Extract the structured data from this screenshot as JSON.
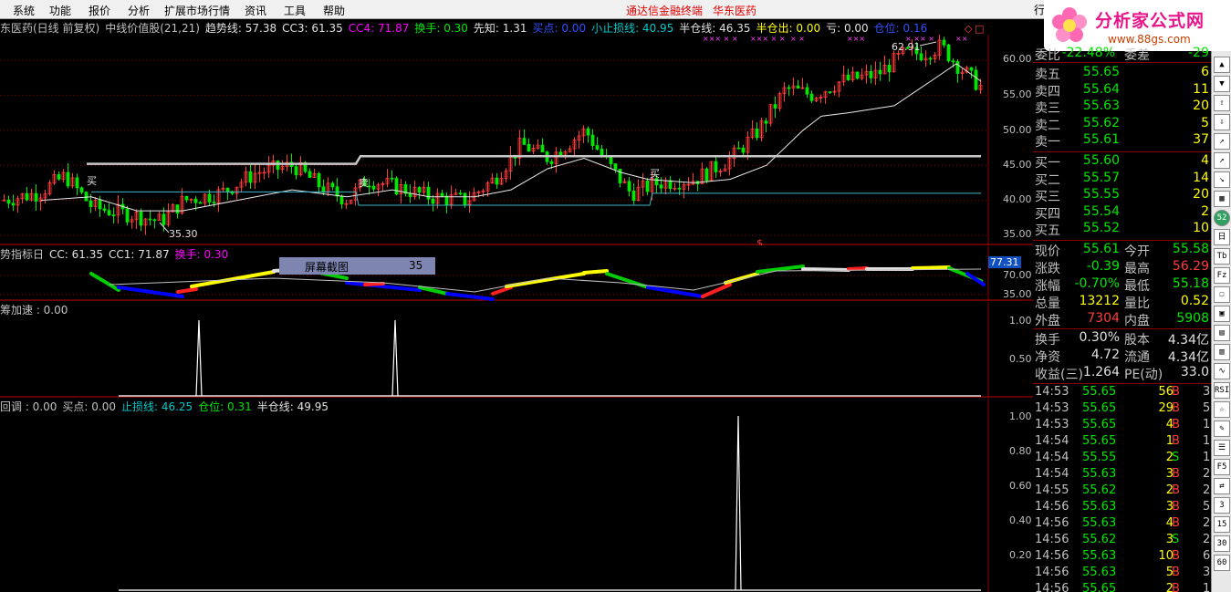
{
  "menu": {
    "items": [
      "系统",
      "功能",
      "报价",
      "分析",
      "扩展市场行情",
      "资讯",
      "工具",
      "帮助"
    ],
    "title": "通达信金融终端",
    "stock": "华东医药",
    "tab_label": "行"
  },
  "logo": {
    "brand": "分析家公式网",
    "url": "www.88gs.com"
  },
  "main_chart": {
    "title_parts": [
      {
        "text": "东医药(日线 前复权)",
        "color": "#c0c0c0"
      },
      {
        "text": "中线价值股(21,21)",
        "color": "#c0c0c0"
      },
      {
        "text": "趋势线: 57.38",
        "color": "#e0e0e0"
      },
      {
        "text": "CC3: 61.35",
        "color": "#e0e0e0"
      },
      {
        "text": "CC4: 71.87",
        "color": "#ff00ff"
      },
      {
        "text": "换手: 0.30",
        "color": "#00e600"
      },
      {
        "text": "先知: 1.31",
        "color": "#e0e0e0"
      },
      {
        "text": "买点: 0.00",
        "color": "#3050ff"
      },
      {
        "text": "小止损线: 40.95",
        "color": "#00c8c8"
      },
      {
        "text": "半仓线: 46.35",
        "color": "#e0e0e0"
      },
      {
        "text": "半仓出: 0.00",
        "color": "#ffff00"
      },
      {
        "text": "亏: 0.00",
        "color": "#e0e0e0"
      },
      {
        "text": "仓位: 0.16",
        "color": "#3050ff"
      }
    ],
    "y_ticks": [
      "60.00",
      "55.00",
      "50.00",
      "45.00",
      "40.00",
      "35.00"
    ],
    "labels": {
      "high": "62.91",
      "low": "35.30",
      "buy1": "买",
      "sell1": "卖",
      "buy2": "买",
      "dollar": "$"
    }
  },
  "indicator1": {
    "title_parts": [
      {
        "text": "势指标日",
        "color": "#c0c0c0"
      },
      {
        "text": "CC: 61.35",
        "color": "#e0e0e0"
      },
      {
        "text": "CC1: 71.87",
        "color": "#e0e0e0"
      },
      {
        "text": "换手: 0.30",
        "color": "#ff00ff"
      }
    ],
    "y_ticks": [
      "77.31",
      "70.00",
      "35.00"
    ]
  },
  "popup": {
    "label": "屏幕截图",
    "value": "35"
  },
  "indicator2": {
    "title_parts": [
      {
        "text": "筹加速 : 0.00",
        "color": "#c0c0c0"
      }
    ],
    "y_ticks": [
      "1.00",
      "0.50"
    ]
  },
  "indicator3": {
    "title_parts": [
      {
        "text": "回调 : 0.00",
        "color": "#c0c0c0"
      },
      {
        "text": "买点: 0.00",
        "color": "#c0c0c0"
      },
      {
        "text": "止损线: 46.25",
        "color": "#00c8c8"
      },
      {
        "text": "仓位: 0.31",
        "color": "#00e600"
      },
      {
        "text": "半仓线: 49.95",
        "color": "#e0e0e0"
      }
    ],
    "y_ticks": [
      "1.00",
      "0.80",
      "0.60",
      "0.40",
      "0.20"
    ]
  },
  "quote": {
    "header": {
      "label": "委比",
      "value": "-22.48%",
      "label2": "委差",
      "value2": "-29"
    },
    "asks": [
      {
        "label": "卖五",
        "price": "55.65",
        "vol": "6"
      },
      {
        "label": "卖四",
        "price": "55.64",
        "vol": "11"
      },
      {
        "label": "卖三",
        "price": "55.63",
        "vol": "20"
      },
      {
        "label": "卖二",
        "price": "55.62",
        "vol": "5"
      },
      {
        "label": "卖一",
        "price": "55.61",
        "vol": "37"
      }
    ],
    "bids": [
      {
        "label": "买一",
        "price": "55.60",
        "vol": "4"
      },
      {
        "label": "买二",
        "price": "55.57",
        "vol": "14"
      },
      {
        "label": "买三",
        "price": "55.55",
        "vol": "20"
      },
      {
        "label": "买四",
        "price": "55.54",
        "vol": "2"
      },
      {
        "label": "买五",
        "price": "55.52",
        "vol": "10"
      }
    ],
    "stats": [
      {
        "l1": "现价",
        "v1": "55.61",
        "c1": "green",
        "l2": "今开",
        "v2": "55.58",
        "c2": "green"
      },
      {
        "l1": "涨跌",
        "v1": "-0.39",
        "c1": "green",
        "l2": "最高",
        "v2": "56.29",
        "c2": "red"
      },
      {
        "l1": "涨幅",
        "v1": "-0.70%",
        "c1": "green",
        "l2": "最低",
        "v2": "55.18",
        "c2": "green"
      },
      {
        "l1": "总量",
        "v1": "13212",
        "c1": "yellow",
        "l2": "量比",
        "v2": "0.52",
        "c2": "yellow"
      },
      {
        "l1": "外盘",
        "v1": "7304",
        "c1": "red",
        "l2": "内盘",
        "v2": "5908",
        "c2": "green"
      }
    ],
    "stats2": [
      {
        "l1": "换手",
        "v1": "0.30%",
        "c1": "white",
        "l2": "股本",
        "v2": "4.34亿",
        "c2": "white"
      },
      {
        "l1": "净资",
        "v1": "4.72",
        "c1": "white",
        "l2": "流通",
        "v2": "4.34亿",
        "c2": "white"
      },
      {
        "l1": "收益(三)",
        "v1": "1.264",
        "c1": "white",
        "l2": "PE(动)",
        "v2": "33.0",
        "c2": "white"
      }
    ],
    "ticks": [
      {
        "time": "14:53",
        "price": "55.65",
        "vol": "56",
        "bs": "B",
        "n": "3"
      },
      {
        "time": "14:53",
        "price": "55.65",
        "vol": "29",
        "bs": "B",
        "n": "5"
      },
      {
        "time": "14:53",
        "price": "55.65",
        "vol": "4",
        "bs": "B",
        "n": "1"
      },
      {
        "time": "14:54",
        "price": "55.65",
        "vol": "1",
        "bs": "B",
        "n": "1"
      },
      {
        "time": "14:54",
        "price": "55.55",
        "vol": "2",
        "bs": "S",
        "n": "1"
      },
      {
        "time": "14:54",
        "price": "55.63",
        "vol": "3",
        "bs": "B",
        "n": "2"
      },
      {
        "time": "14:55",
        "price": "55.62",
        "vol": "2",
        "bs": "B",
        "n": "2"
      },
      {
        "time": "14:56",
        "price": "55.63",
        "vol": "3",
        "bs": "B",
        "n": "5"
      },
      {
        "time": "14:56",
        "price": "55.63",
        "vol": "4",
        "bs": "B",
        "n": "2"
      },
      {
        "time": "14:56",
        "price": "55.62",
        "vol": "3",
        "bs": "S",
        "n": "2"
      },
      {
        "time": "14:56",
        "price": "55.63",
        "vol": "10",
        "bs": "B",
        "n": "6"
      },
      {
        "time": "14:56",
        "price": "55.63",
        "vol": "5",
        "bs": "B",
        "n": "3"
      },
      {
        "time": "14:56",
        "price": "55.65",
        "vol": "2",
        "bs": "B",
        "n": "1"
      }
    ]
  },
  "toolbar": {
    "buttons": [
      "▲",
      "▼",
      "⇧",
      "⇩",
      "↗",
      "↗",
      "↘",
      "▦",
      "52",
      "日",
      "Tb",
      "Fz",
      "☐",
      "▣",
      "▤",
      "▥",
      "∿",
      "RSI",
      "☆",
      "✎",
      "☰",
      "F5",
      "⇄",
      "3",
      "15",
      "30",
      "60"
    ]
  },
  "colors": {
    "up": "#ff3c3c",
    "down": "#00e600",
    "grid": "#8b0000",
    "bg": "#000000"
  }
}
